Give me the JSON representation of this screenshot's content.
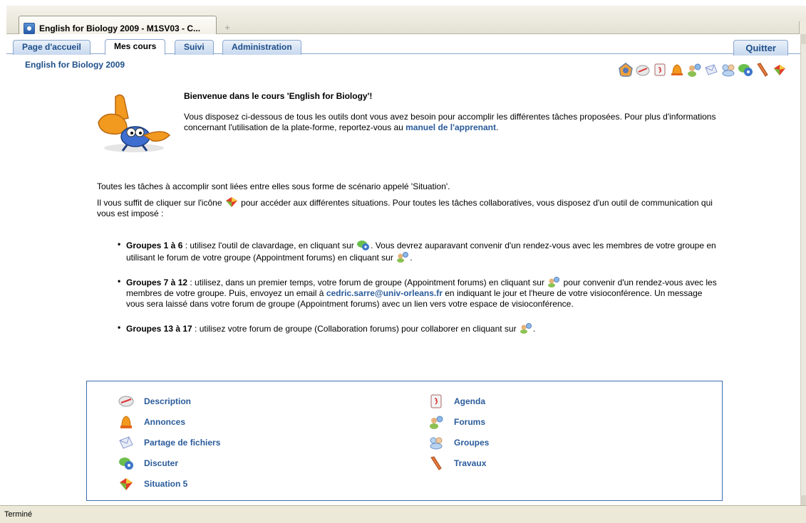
{
  "window": {
    "tab_title": "English for Biology 2009 - M1SV03 - C...",
    "tab_close": "✕",
    "new_tab": "+",
    "status": "Terminé"
  },
  "nav": {
    "tabs": [
      "Page d'accueil",
      "Mes cours",
      "Suivi",
      "Administration"
    ],
    "active_tab": "Mes cours",
    "quit_label": "Quitter"
  },
  "course": {
    "title": "English for Biology 2009"
  },
  "toolbar": {
    "icons": [
      "home-icon",
      "compass-icon",
      "calendar-icon",
      "bell-icon",
      "forum-icon",
      "envelope-icon",
      "group-icon",
      "chat-icon",
      "pencil-icon",
      "situation-icon"
    ]
  },
  "welcome": {
    "title": "Bienvenue dans le cours 'English for Biology'!",
    "intro": "Vous disposez ci-dessous de tous les outils dont vous avez besoin pour accomplir les différentes tâches proposées. Pour plus d'informations concernant l'utilisation de la plate-forme, reportez-vous au ",
    "manual_link": "manuel de l'apprenant",
    "after_link": "."
  },
  "body": {
    "p1": "Toutes les tâches à accomplir sont liées entre elles sous forme de scénario appelé 'Situation'.",
    "p2_before": "Il vous suffit de cliquer sur l'icône ",
    "p2_after": " pour accéder aux différentes situations. Pour toutes les tâches collaboratives, vous disposez d'un outil de communication qui vous est imposé :"
  },
  "groups": {
    "g1_label": "Groupes 1 à 6",
    "g1_text": " : utilisez l'outil de clavardage, en cliquant sur ",
    "g1_text2": ". Vous devrez auparavant convenir d'un rendez-vous avec les membres de votre groupe en utilisant le forum de votre groupe (Appointment forums) en cliquant sur ",
    "g1_end": ".",
    "g2_label": "Groupes 7 à 12",
    "g2_text": " : utilisez, dans un premier temps, votre forum de groupe (Appointment forums) en cliquant sur ",
    "g2_text2": " pour convenir d'un rendez-vous avec les membres de votre groupe. Puis, envoyez un email à ",
    "g2_email": "cedric.sarre@univ-orleans.fr",
    "g2_text3": " en indiquant le jour et l'heure de votre visioconférence. Un message vous sera laissé dans votre forum de groupe (Appointment forums)  avec un lien vers votre espace de visioconférence.",
    "g3_label": "Groupes 13 à 17",
    "g3_text": " : utilisez votre forum de groupe (Collaboration forums) pour collaborer en cliquant sur ",
    "g3_end": "."
  },
  "tools": {
    "left": [
      "Description",
      "Annonces",
      "Partage de fichiers",
      "Discuter",
      "Situation 5"
    ],
    "right": [
      "Agenda",
      "Forums",
      "Groupes",
      "Travaux"
    ]
  },
  "colors": {
    "link": "#2a5b9a",
    "nav_text": "#1e4f8a",
    "box_border": "#3a6eb2"
  }
}
